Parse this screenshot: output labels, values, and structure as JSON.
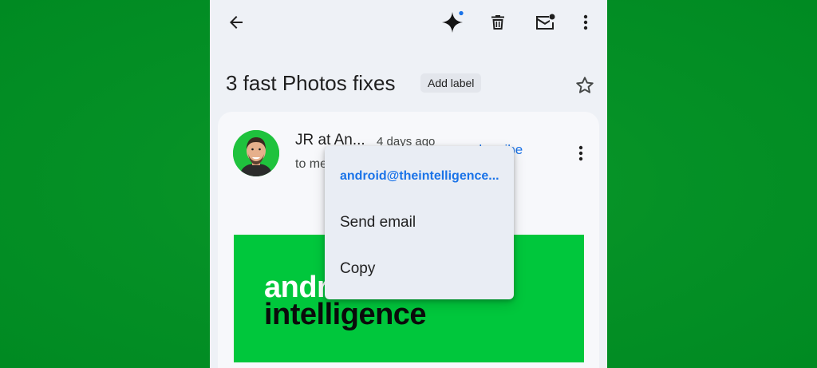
{
  "toolbar": {
    "back_icon": "arrow-back-icon",
    "gemini_icon": "sparkle-icon",
    "delete_icon": "trash-icon",
    "mark_unread_icon": "mail-unread-icon",
    "more_icon": "more-vertical-icon"
  },
  "email": {
    "subject": "3 fast Photos fixes",
    "add_label": "Add label",
    "star_icon": "star-outline-icon",
    "sender": "JR at An...",
    "time": "4 days ago",
    "recipient": "to me",
    "unsubscribe": "nsubscribe",
    "banner": {
      "line1": "andr",
      "line2": "intelligence"
    }
  },
  "popup_menu": {
    "items": [
      {
        "label": "android@theintelligence..."
      },
      {
        "label": "Send email"
      },
      {
        "label": "Copy"
      }
    ]
  },
  "colors": {
    "background_green": "#059126",
    "accent_blue": "#1a73e8",
    "banner_green": "#00c73c"
  }
}
